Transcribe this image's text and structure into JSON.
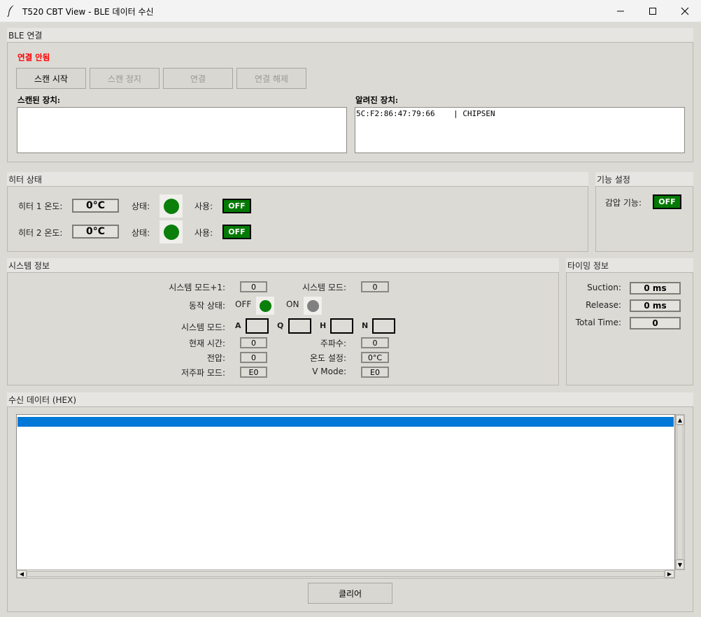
{
  "window": {
    "title": "T520 CBT View - BLE 데이터 수신",
    "icon": "feather-icon",
    "controls": [
      "minimize-icon",
      "maximize-icon",
      "close-icon"
    ]
  },
  "ble": {
    "section_title": "BLE 연결",
    "status": "연결 안됨",
    "status_color": "#ff0000",
    "buttons": {
      "scan_start": "스캔 시작",
      "scan_stop": "스캔 정지",
      "connect": "연결",
      "disconnect": "연결 해제"
    },
    "scanned_label": "스캔된 장치:",
    "known_label": "알려진 장치:",
    "scanned_devices": [],
    "known_devices": [
      "5C:F2:86:47:79:66    | CHIPSEN"
    ]
  },
  "heater": {
    "section_title": "히터 상태",
    "heater1_label": "히터 1 온도:",
    "heater1_temp": "0°C",
    "heater2_label": "히터 2 온도:",
    "heater2_temp": "0°C",
    "status_label": "상태:",
    "use_label": "사용:",
    "use1": "OFF",
    "use2": "OFF",
    "led_color": "#0a7f0a"
  },
  "function": {
    "section_title": "기능 설정",
    "decompress_label": "감압 기능:",
    "decompress_value": "OFF"
  },
  "system": {
    "section_title": "시스템 정보",
    "mode_plus1_label": "시스템 모드+1:",
    "mode_plus1_value": "0",
    "mode_label": "시스템 모드:",
    "mode_value": "0",
    "op_state_label": "동작 상태:",
    "off_label": "OFF",
    "on_label": "ON",
    "off_led_color": "#0a7f0a",
    "on_led_color": "#808080",
    "mode2_label": "시스템 모드:",
    "mode_letters": [
      "A",
      "Q",
      "H",
      "N"
    ],
    "current_time_label": "현재 시간:",
    "current_time_value": "0",
    "frequency_label": "주파수:",
    "frequency_value": "0",
    "voltage_label": "전압:",
    "voltage_value": "0",
    "temp_setting_label": "온도 설정:",
    "temp_setting_value": "0°C",
    "low_freq_label": "저주파 모드:",
    "low_freq_value": "E0",
    "vmode_label": "V Mode:",
    "vmode_value": "E0"
  },
  "timing": {
    "section_title": "타이밍 정보",
    "suction_label": "Suction:",
    "suction_value": "0 ms",
    "release_label": "Release:",
    "release_value": "0 ms",
    "total_label": "Total Time:",
    "total_value": "0"
  },
  "rx": {
    "section_title": "수신 데이터 (HEX)",
    "selected_row_color": "#0078d7",
    "clear_button": "클리어"
  }
}
